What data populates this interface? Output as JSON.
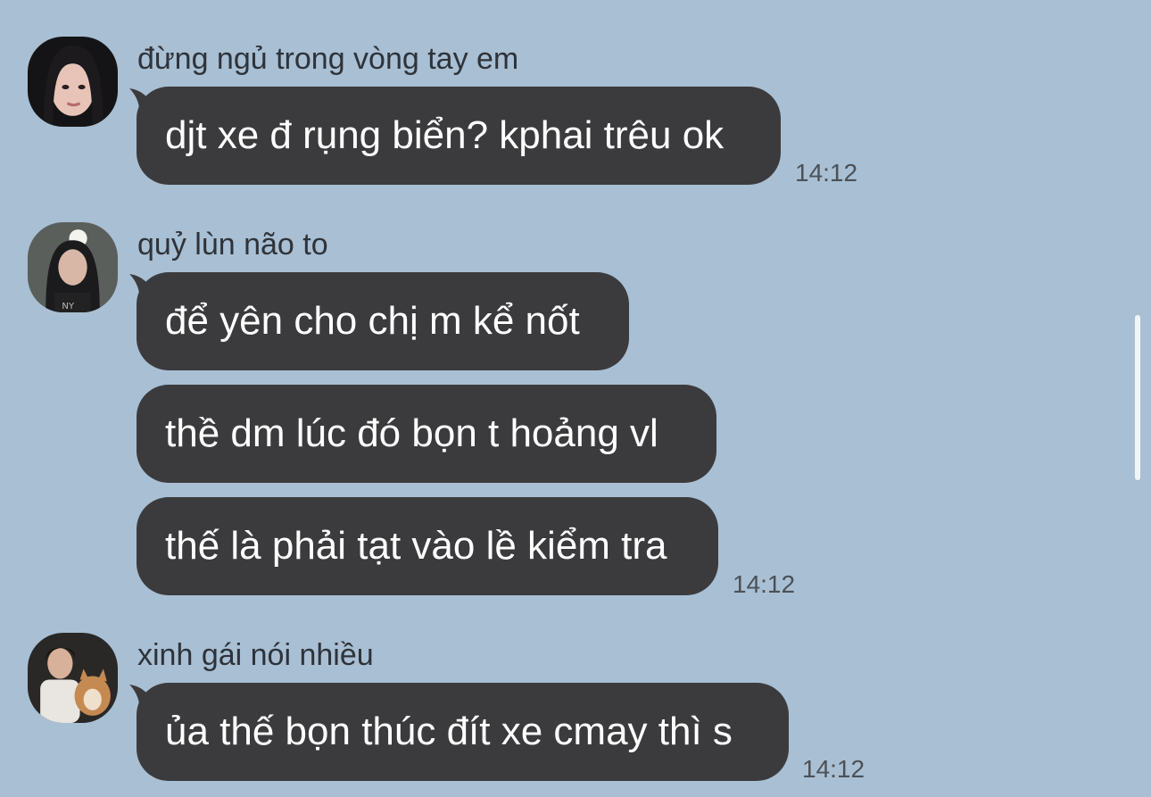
{
  "colors": {
    "background": "#a9bfd3",
    "bubble": "#3b3b3e",
    "bubble_text": "#ffffff",
    "sender_text": "#2e333a",
    "time_text": "#4b5158"
  },
  "groups": [
    {
      "sender": "đừng ngủ trong vòng tay em",
      "avatar_icon": "user-avatar-photo",
      "messages": [
        "djt xe đ rụng biển? kphai trêu ok"
      ],
      "time": "14:12"
    },
    {
      "sender": "quỷ lùn não to",
      "avatar_icon": "user-avatar-photo",
      "messages": [
        "để yên cho chị m kể nốt",
        "thề dm lúc đó bọn t hoảng vl",
        "thế là phải tạt vào lề kiểm tra"
      ],
      "time": "14:12"
    },
    {
      "sender": "xinh gái nói nhiều",
      "avatar_icon": "user-avatar-photo",
      "messages": [
        "ủa thế bọn thúc đít xe cmay thì s"
      ],
      "time": "14:12"
    }
  ]
}
